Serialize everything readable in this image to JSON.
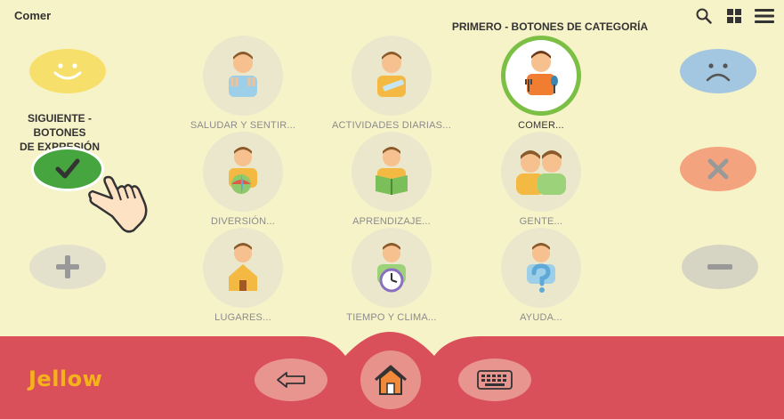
{
  "header": {
    "title": "Comer"
  },
  "icons": {
    "search": "search-icon",
    "grid": "grid-icon",
    "menu": "menu-icon"
  },
  "notes": {
    "category_hint": "PRIMERO - BOTONES DE CATEGORÍA",
    "expression_hint_line1": "SIGUIENTE - BOTONES",
    "expression_hint_line2": "DE EXPRESIÓN"
  },
  "categories": [
    {
      "label": "SALUDAR Y SENTIR...",
      "icon": "greet-feel-icon"
    },
    {
      "label": "ACTIVIDADES DIARIAS...",
      "icon": "daily-activities-icon"
    },
    {
      "label": "COMER...",
      "icon": "eat-icon",
      "selected": true
    },
    {
      "label": "DIVERSIÓN...",
      "icon": "fun-icon"
    },
    {
      "label": "APRENDIZAJE...",
      "icon": "learning-icon"
    },
    {
      "label": "GENTE...",
      "icon": "people-icon"
    },
    {
      "label": "LUGARES...",
      "icon": "places-icon"
    },
    {
      "label": "TIEMPO Y CLIMA...",
      "icon": "time-weather-icon"
    },
    {
      "label": "AYUDA...",
      "icon": "help-icon"
    }
  ],
  "expressions": {
    "left": [
      "like",
      "yes",
      "more"
    ],
    "right": [
      "dislike",
      "no",
      "less"
    ]
  },
  "footer": {
    "logo": "Jellow"
  },
  "colors": {
    "background": "#f7f3c9",
    "footer": "#d9505a",
    "selected_ring": "#7cbf45",
    "accent": "#f6b21c"
  }
}
